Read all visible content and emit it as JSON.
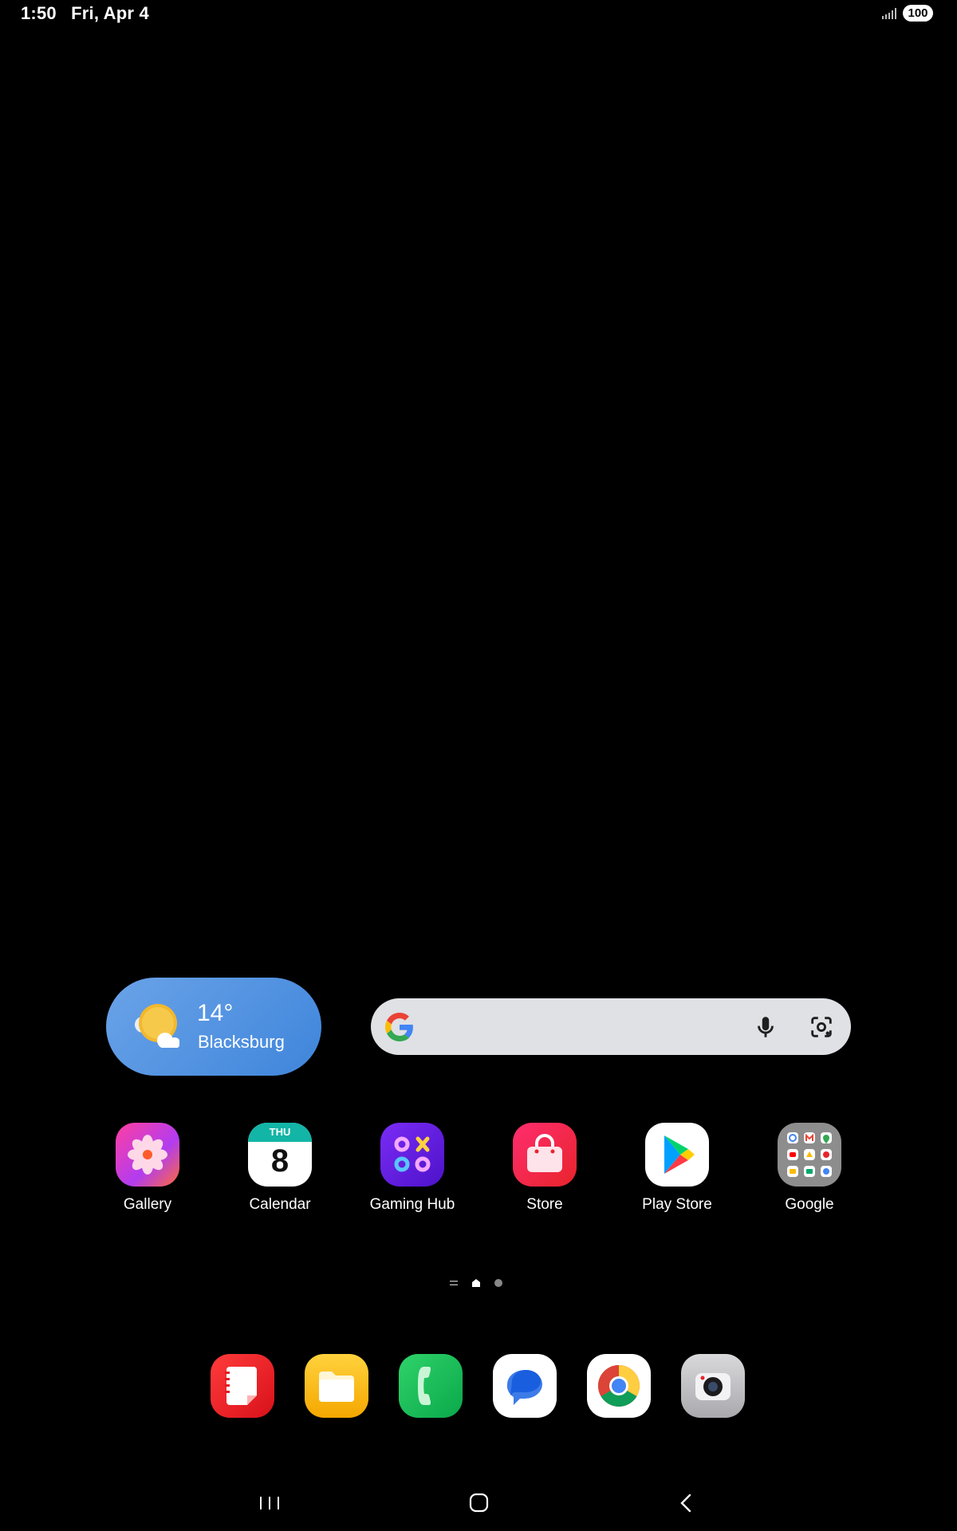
{
  "status_bar": {
    "time": "1:50",
    "date": "Fri, Apr 4",
    "battery": "100",
    "signal_icon": "signal-icon"
  },
  "weather": {
    "temperature": "14°",
    "location": "Blacksburg",
    "icon": "partly-sunny-icon"
  },
  "search_bar": {
    "logo": "google-g-icon",
    "voice_icon": "microphone-icon",
    "lens_icon": "camera-lens-icon"
  },
  "apps": [
    {
      "label": "Gallery",
      "icon": "gallery-icon"
    },
    {
      "label": "Calendar",
      "icon": "calendar-icon",
      "day": "THU",
      "date": "8"
    },
    {
      "label": "Gaming Hub",
      "icon": "gaming-hub-icon"
    },
    {
      "label": "Store",
      "icon": "store-icon"
    },
    {
      "label": "Play Store",
      "icon": "play-store-icon"
    },
    {
      "label": "Google",
      "icon": "google-folder-icon"
    }
  ],
  "dock": [
    {
      "name": "Notes",
      "icon": "notes-icon"
    },
    {
      "name": "My Files",
      "icon": "folder-icon"
    },
    {
      "name": "Phone",
      "icon": "phone-icon"
    },
    {
      "name": "Messages",
      "icon": "messages-icon"
    },
    {
      "name": "Chrome",
      "icon": "chrome-icon"
    },
    {
      "name": "Camera",
      "icon": "camera-icon"
    }
  ],
  "nav_bar": {
    "recents": "recents-icon",
    "home": "home-icon",
    "back": "back-icon"
  },
  "colors": {
    "background": "#000000",
    "weather_widget": "#4f8fe0",
    "search_bar": "#dfe1e5"
  }
}
